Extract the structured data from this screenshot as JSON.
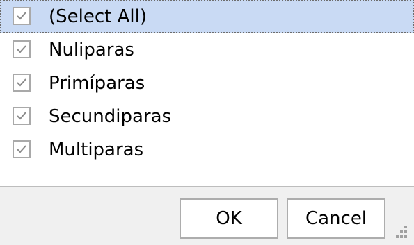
{
  "filter_list": {
    "items": [
      {
        "label": "(Select All)",
        "checked": true,
        "selected": true
      },
      {
        "label": "Nuliparas",
        "checked": true,
        "selected": false
      },
      {
        "label": "Primíparas",
        "checked": true,
        "selected": false
      },
      {
        "label": "Secundiparas",
        "checked": true,
        "selected": false
      },
      {
        "label": "Multiparas",
        "checked": true,
        "selected": false
      }
    ]
  },
  "footer": {
    "ok_label": "OK",
    "cancel_label": "Cancel"
  },
  "colors": {
    "selection": "#c9daf4",
    "checkbox_border": "#a9a9a9",
    "checkmark": "#8a8a8a",
    "footer_bg": "#f0f0f0"
  }
}
